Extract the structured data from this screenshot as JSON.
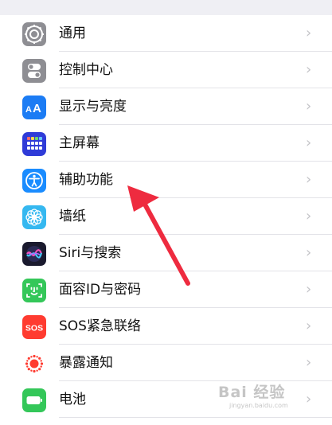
{
  "settings": {
    "items": [
      {
        "label": "通用",
        "icon": "gear-icon",
        "color": "#8e8e93"
      },
      {
        "label": "控制中心",
        "icon": "toggles-icon",
        "color": "#8e8e93"
      },
      {
        "label": "显示与亮度",
        "icon": "text-size-icon",
        "color": "#1c7cf4"
      },
      {
        "label": "主屏幕",
        "icon": "home-grid-icon",
        "color": "#2f3bd8"
      },
      {
        "label": "辅助功能",
        "icon": "accessibility-icon",
        "color": "#1a8cff"
      },
      {
        "label": "墙纸",
        "icon": "flower-icon",
        "color": "#35b8f0"
      },
      {
        "label": "Siri与搜索",
        "icon": "siri-icon",
        "color": "#1a1a2e"
      },
      {
        "label": "面容ID与密码",
        "icon": "face-id-icon",
        "color": "#34c759"
      },
      {
        "label": "SOS紧急联络",
        "icon": "sos-icon",
        "color": "#ff3b30"
      },
      {
        "label": "暴露通知",
        "icon": "exposure-icon",
        "color": "#ffffff"
      },
      {
        "label": "电池",
        "icon": "battery-icon",
        "color": "#34c759"
      }
    ],
    "chevron": "›",
    "sos_text": "SOS"
  },
  "watermark": {
    "main": "Bai 经验",
    "sub": "jingyan.baidu.com"
  }
}
